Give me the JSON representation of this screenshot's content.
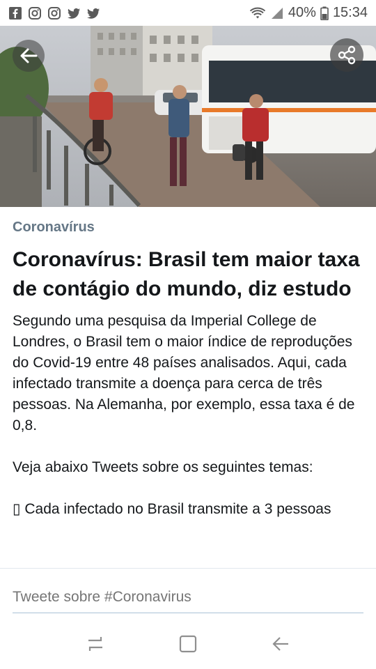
{
  "status_bar": {
    "app_icons": [
      "facebook-icon",
      "instagram-icon",
      "instagram-icon",
      "twitter-icon",
      "twitter-icon"
    ],
    "battery_percent": "40%",
    "time": "15:34"
  },
  "hero": {
    "image_description_icon": "photo",
    "back_icon": "back-arrow-icon",
    "share_icon": "share-icon"
  },
  "article": {
    "category": "Coronavírus",
    "headline": "Coronavírus: Brasil tem maior taxa de contágio do mundo, diz estudo",
    "paragraph_1": "Segundo uma pesquisa da Imperial College de Londres, o Brasil tem o maior índice de reproduções do Covid-19 entre 48 países analisados. Aqui, cada infectado transmite a doença para cerca de três pessoas. Na Alemanha, por exemplo, essa taxa é de 0,8.",
    "paragraph_2": "Veja abaixo Tweets sobre os seguintes temas:",
    "paragraph_3": "▯ Cada infectado no Brasil transmite a 3 pessoas"
  },
  "tweet_bar": {
    "placeholder": "Tweete sobre #Coronavirus"
  },
  "colors": {
    "category": "#657786",
    "text": "#14171a",
    "divider": "#a9c2d6"
  }
}
